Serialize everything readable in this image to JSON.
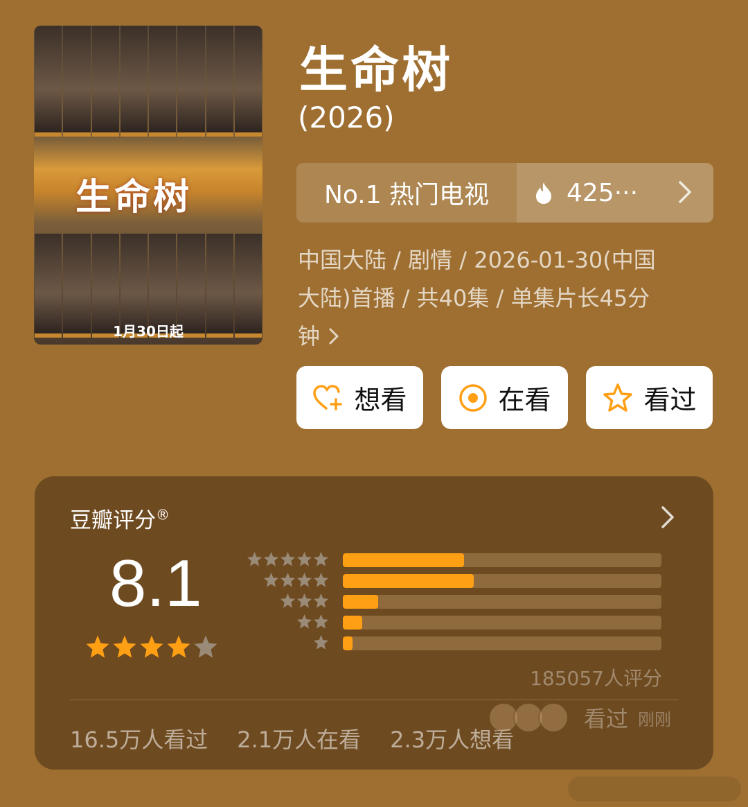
{
  "poster": {
    "logo_text": "生命树",
    "date_text": "1月30日起"
  },
  "title": "生命树",
  "year": "(2026)",
  "rank": {
    "label": "No.1 热门电视",
    "value": "425···",
    "icon": "fire-icon"
  },
  "meta_line1": "中国大陆 / 剧情 / 2026-01-30(中国",
  "meta_line2": "大陆)首播 / 共40集 / 单集片长45分",
  "meta_line3": "钟",
  "buttons": {
    "want": "想看",
    "watching": "在看",
    "watched": "看过"
  },
  "rating": {
    "title": "豆瓣评分",
    "reg": "®",
    "score": "8.1",
    "stars_filled": 4,
    "distribution": [
      0.38,
      0.41,
      0.11,
      0.06,
      0.03
    ],
    "count": "185057人评分"
  },
  "stats": {
    "watched": "16.5万人看过",
    "watching": "2.1万人在看",
    "want": "2.3万人想看"
  },
  "recent": {
    "label": "看过",
    "time": "刚刚"
  },
  "colors": {
    "background": "#9e6f31",
    "card": "#6e4a20",
    "accent": "#ff9f14"
  }
}
